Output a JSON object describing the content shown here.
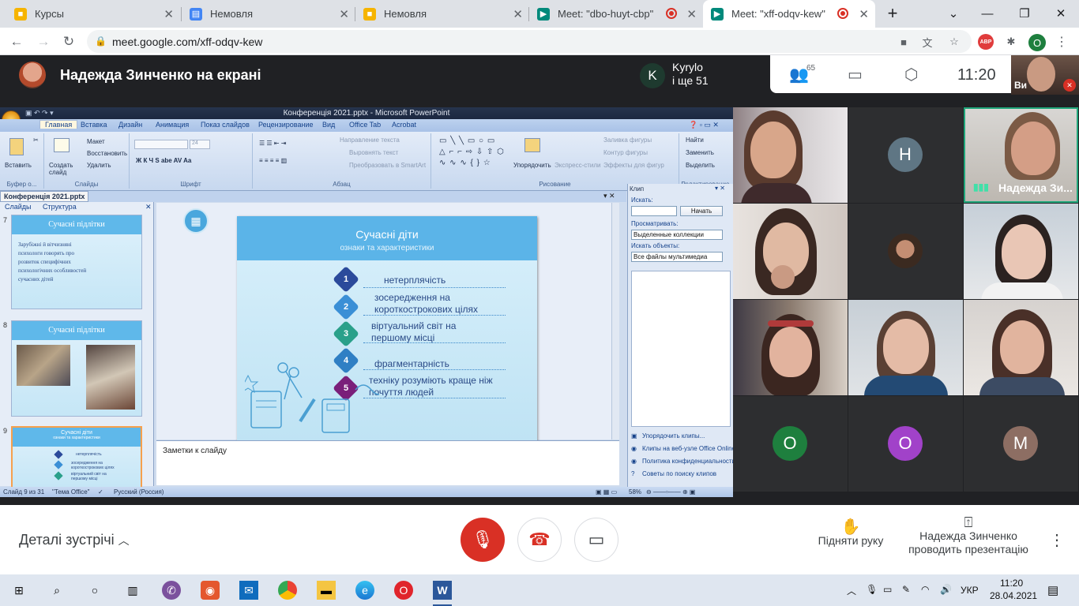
{
  "browser": {
    "tabs": [
      {
        "title": "Курсы",
        "favicon": "classroom-icon"
      },
      {
        "title": "Немовля",
        "favicon": "docs-icon"
      },
      {
        "title": "Немовля",
        "favicon": "classroom-icon"
      },
      {
        "title": "Meet: \"dbo-huyt-cbp\"",
        "favicon": "meet-icon",
        "recording": true
      },
      {
        "title": "Meet: \"xff-odqv-kew\"",
        "favicon": "meet-icon",
        "recording": true,
        "active": true
      }
    ],
    "url": "meet.google.com/xff-odqv-kew",
    "abp_badge": "ABP",
    "profile_initial": "O"
  },
  "meet": {
    "presenting_title": "Надежда Зинченко на екрані",
    "join_name": "Kyrylo",
    "join_more": "і ще 51",
    "join_initial": "K",
    "people_count": "65",
    "time": "11:20",
    "self_label": "Ви",
    "participants": [
      {
        "name": "Надежда Зи...",
        "speaking": true
      },
      {
        "initial": "H",
        "color": "#5f7684"
      },
      {
        "initial": "O",
        "color": "#1e7f3e"
      },
      {
        "initial": "O",
        "color": "#a142c9"
      },
      {
        "initial": "M",
        "color": "#8d6e63"
      }
    ],
    "details_label": "Деталі зустрічі",
    "raise_hand": "Підняти руку",
    "presenting_line1": "Надежда Зинченко",
    "presenting_line2": "проводить презентацію",
    "colors": {
      "end_call": "#d93025",
      "mic_off": "#d93025"
    }
  },
  "ppt": {
    "window_title": "Конференція 2021.pptx - Microsoft PowerPoint",
    "ribbon_tabs": [
      "Главная",
      "Вставка",
      "Дизайн",
      "Анимация",
      "Показ слайдов",
      "Рецензирование",
      "Вид",
      "Office Tab",
      "Acrobat"
    ],
    "groups": {
      "clipboard": "Буфер о...",
      "slides": "Слайды",
      "font": "Шрифт",
      "paragraph": "Абзац",
      "drawing": "Рисование",
      "editing": "Редактирование"
    },
    "ribbon_items": {
      "paste": "Вставить",
      "new_slide": "Создать слайд",
      "layout": "Макет",
      "reset": "Восстановить",
      "delete": "Удалить",
      "font_size": "24",
      "text_direction": "Направление текста",
      "align_text": "Выровнять текст",
      "smartart": "Преобразовать в SmartArt",
      "arrange": "Упорядочить",
      "quick_styles": "Экспресс-стили",
      "shape_fill": "Заливка фигуры",
      "shape_outline": "Контур фигуры",
      "shape_effects": "Эффекты для фигур",
      "find": "Найти",
      "replace": "Заменить",
      "select": "Выделить"
    },
    "doc_tab": "Конференція 2021.pptx",
    "panel_tabs": [
      "Слайды",
      "Структура"
    ],
    "thumbs": [
      {
        "num": "7",
        "title": "Сучасні підлітки",
        "text": "Зарубіжні й вітчизняні психологи говорять про розвиток специфічних психологічних особливостей сучасних дітей"
      },
      {
        "num": "8",
        "title": "Сучасні підлітки"
      },
      {
        "num": "9",
        "title": "Сучасні діти",
        "sub": "ознаки та характеристики",
        "items": [
          "нетерплячість",
          "зосередження на короткострокових цілях",
          "віртуальний світ на першому місці"
        ]
      }
    ],
    "slide": {
      "title": "Сучасні діти",
      "subtitle": "ознаки та характеристики",
      "items": [
        {
          "num": "1",
          "text": "нетерплячість",
          "color": "#2b4a9b"
        },
        {
          "num": "2",
          "text": "зосередження на короткострокових цілях",
          "color": "#3a8fd6"
        },
        {
          "num": "3",
          "text": "віртуальний світ на першому місці",
          "color": "#2aa08a"
        },
        {
          "num": "4",
          "text": "фрагментарність",
          "color": "#2f7fc4"
        },
        {
          "num": "5",
          "text": "техніку розуміють краще ніж почуття людей",
          "color": "#7a1f7a"
        }
      ]
    },
    "notes_placeholder": "Заметки к слайду",
    "clip": {
      "title": "Клип",
      "search_label": "Искать:",
      "start_btn": "Начать",
      "browse_label": "Просматривать:",
      "browse_value": "Выделенные коллекции",
      "objects_label": "Искать объекты:",
      "objects_value": "Все файлы мультимедиа",
      "links": [
        "Упорядочить клипы...",
        "Клипы на веб-узле Office Online",
        "Политика конфиденциальности",
        "Советы по поиску клипов"
      ]
    },
    "status": {
      "slide": "Слайд 9 из 31",
      "theme": "\"Тема Office\"",
      "lang": "Русский (Россия)",
      "zoom": "58%"
    }
  },
  "taskbar": {
    "lang": "УКР",
    "time": "11:20",
    "date": "28.04.2021"
  }
}
